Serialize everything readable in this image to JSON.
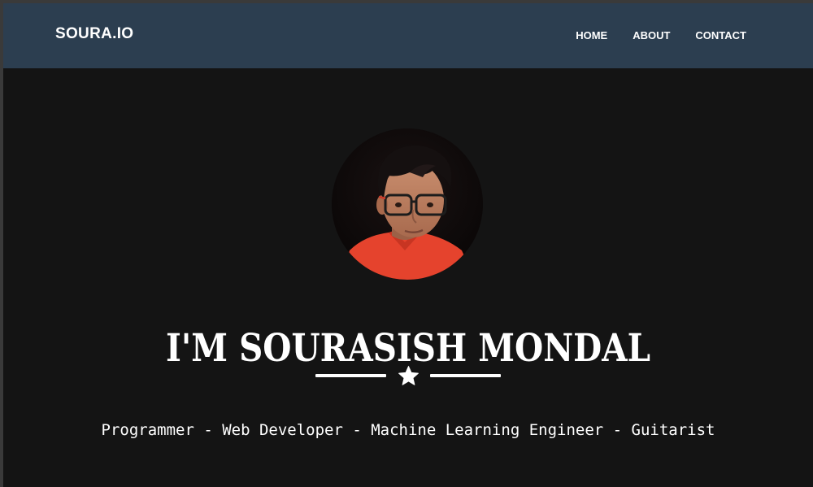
{
  "navbar": {
    "brand": "SOURA.IO",
    "links": [
      {
        "label": "HOME"
      },
      {
        "label": "ABOUT"
      },
      {
        "label": "CONTACT"
      }
    ]
  },
  "hero": {
    "title": "I'M SOURASISH MONDAL",
    "subtitle": "Programmer - Web Developer - Machine Learning Engineer - Guitarist",
    "divider_icon": "star-icon",
    "avatar_icon": "profile-photo"
  },
  "colors": {
    "navbar_bg": "#2c3e50",
    "page_bg": "#141414",
    "text": "#ffffff",
    "shirt_accent": "#e8442e"
  }
}
